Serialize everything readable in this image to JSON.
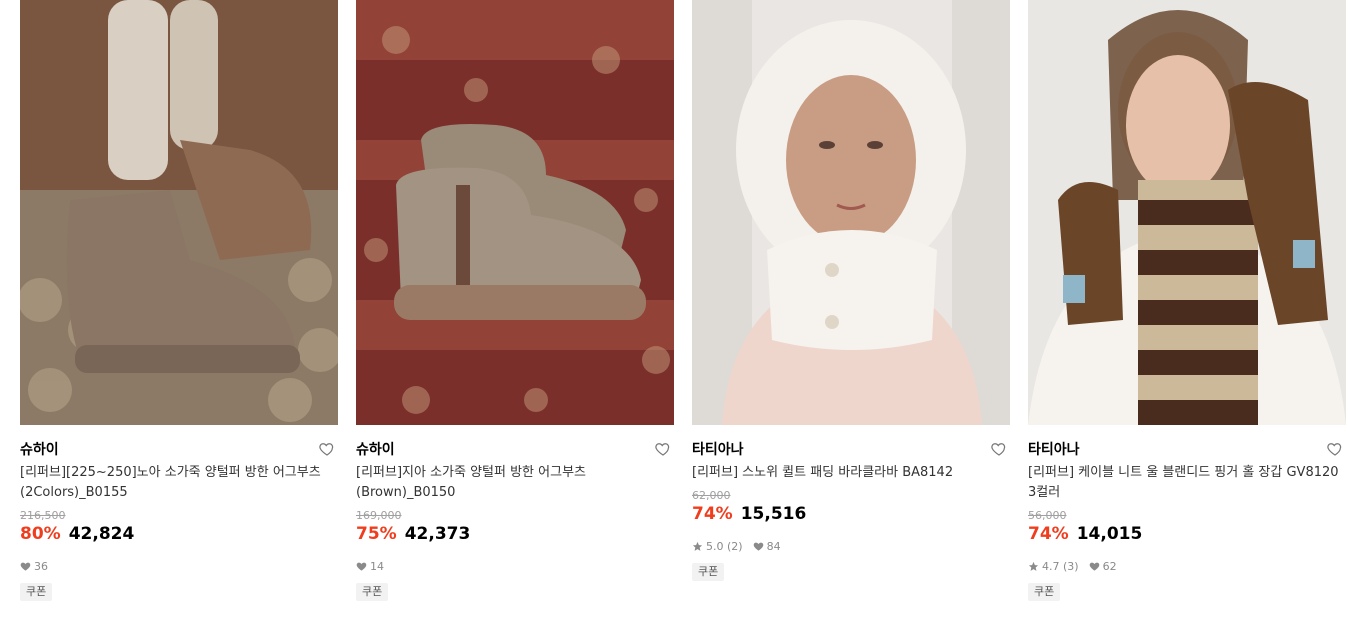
{
  "products": [
    {
      "brand": "슈하이",
      "name": "[리퍼브][225~250]노아 소가죽 양털퍼 방한 어그부츠(2Colors)_B0155",
      "original_price": "216,500",
      "discount": "80%",
      "price": "42,824",
      "rating": "",
      "likes": "36",
      "coupon": "쿠폰",
      "image_icon": "boots-photo-icon"
    },
    {
      "brand": "슈하이",
      "name": "[리퍼브]지아 소가죽 양털퍼 방한 어그부츠(Brown)_B0150",
      "original_price": "169,000",
      "discount": "75%",
      "price": "42,373",
      "rating": "",
      "likes": "14",
      "coupon": "쿠폰",
      "image_icon": "boots-photo-icon"
    },
    {
      "brand": "타티아나",
      "name": "[리퍼브] 스노위 퀼트 패딩 바라클라바 BA8142",
      "original_price": "62,000",
      "discount": "74%",
      "price": "15,516",
      "rating": "5.0 (2)",
      "likes": "84",
      "coupon": "쿠폰",
      "image_icon": "balaclava-photo-icon"
    },
    {
      "brand": "타티아나",
      "name": "[리퍼브] 케이블 니트 울 블랜디드 핑거 홀 장갑 GV8120 3컬러",
      "original_price": "56,000",
      "discount": "74%",
      "price": "14,015",
      "rating": "4.7 (3)",
      "likes": "62",
      "coupon": "쿠폰",
      "image_icon": "gloves-photo-icon"
    }
  ],
  "colors": {
    "discount": "#ef3d1e",
    "muted": "#a0a0a0",
    "coupon_bg": "#f2f2f2"
  }
}
